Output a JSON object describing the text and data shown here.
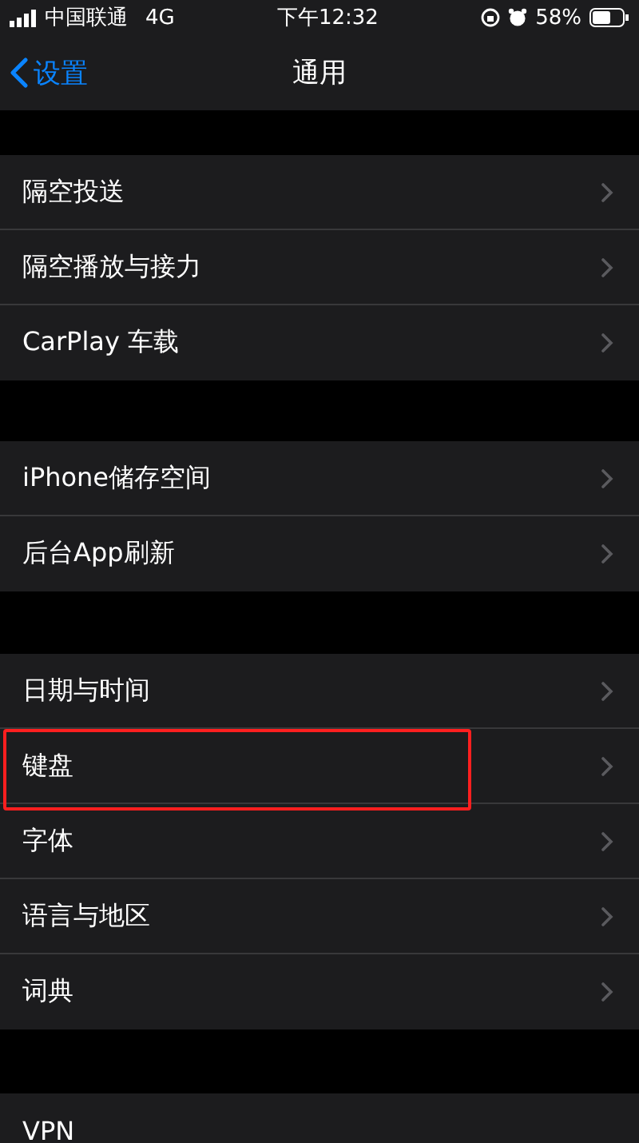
{
  "status_bar": {
    "carrier": "中国联通",
    "network": "4G",
    "time": "下午12:32",
    "battery": "58%"
  },
  "nav": {
    "back": "设置",
    "title": "通用"
  },
  "groups": [
    {
      "rows": [
        {
          "label": "隔空投送",
          "chevron": true,
          "highlighted": false
        },
        {
          "label": "隔空播放与接力",
          "chevron": true,
          "highlighted": false
        },
        {
          "label": "CarPlay 车载",
          "chevron": true,
          "highlighted": false
        }
      ]
    },
    {
      "rows": [
        {
          "label": "iPhone储存空间",
          "chevron": true,
          "highlighted": false
        },
        {
          "label": "后台App刷新",
          "chevron": true,
          "highlighted": false
        }
      ]
    },
    {
      "rows": [
        {
          "label": "日期与时间",
          "chevron": true,
          "highlighted": false
        },
        {
          "label": "键盘",
          "chevron": true,
          "highlighted": true
        },
        {
          "label": "字体",
          "chevron": true,
          "highlighted": false
        },
        {
          "label": "语言与地区",
          "chevron": true,
          "highlighted": false
        },
        {
          "label": "词典",
          "chevron": true,
          "highlighted": false
        }
      ]
    },
    {
      "rows": [
        {
          "label": "VPN",
          "chevron": false,
          "highlighted": false
        }
      ]
    }
  ]
}
